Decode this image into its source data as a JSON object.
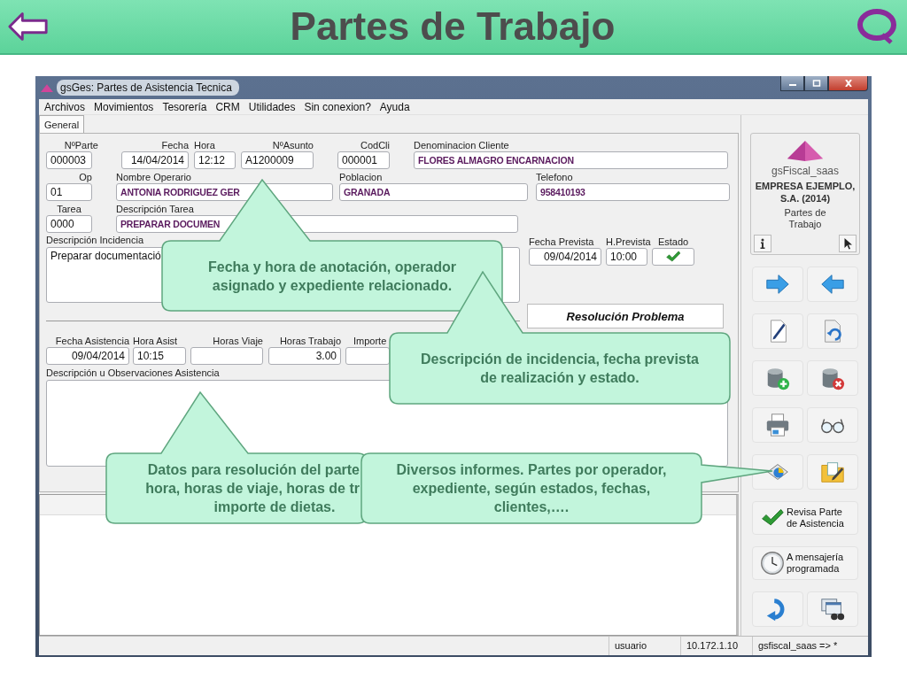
{
  "slide": {
    "title": "Partes de Trabajo"
  },
  "window": {
    "title": "gsGes: Partes de Asistencia Tecnica",
    "menu": [
      "Archivos",
      "Movimientos",
      "Tesorería",
      "CRM",
      "Utilidades",
      "Sin conexion?",
      "Ayuda"
    ],
    "tabs": [
      {
        "label": "General",
        "selected": true
      }
    ],
    "form": {
      "top_rows": [
        [
          {
            "label": "NºParte",
            "value": "000003",
            "kind": "code"
          },
          {
            "label": "Fecha",
            "value": "14/04/2014",
            "kind": "number"
          },
          {
            "label": "Hora",
            "value": "12:12",
            "kind": "code"
          },
          {
            "label": "NºAsunto",
            "value": "A1200009",
            "kind": "code"
          },
          {
            "label": "CodCli",
            "value": "000001",
            "kind": "code"
          },
          {
            "label": "Denominacion Cliente",
            "value": "FLORES ALMAGRO ENCARNACION",
            "kind": "name"
          }
        ],
        [
          {
            "label": "Op",
            "value": "01",
            "kind": "code"
          },
          {
            "label": "Nombre Operario",
            "value": "ANTONIA RODRIGUEZ GER",
            "kind": "name"
          },
          {
            "label": "Poblacion",
            "value": "GRANADA",
            "kind": "name"
          },
          {
            "label": "Telefono",
            "value": "958410193",
            "kind": "name"
          }
        ],
        [
          {
            "label": "Tarea",
            "value": "0000",
            "kind": "code"
          },
          {
            "label": "Descripción Tarea",
            "value": "PREPARAR DOCUMEN",
            "kind": "name"
          }
        ],
        [
          {
            "label": "Descripción Incidencia",
            "value": "Preparar documentació",
            "kind": "memo"
          },
          {
            "label": "Fecha Prevista",
            "value": "09/04/2014",
            "kind": "number"
          },
          {
            "label": "H.Prevista",
            "value": "10:00",
            "kind": "code"
          },
          {
            "label": "Estado",
            "kind": "status",
            "checked": true
          }
        ]
      ],
      "section_title": "Resolución Problema",
      "bottom_rows": [
        [
          {
            "label": "Fecha Asistencia",
            "value": "09/04/2014",
            "kind": "number"
          },
          {
            "label": "Hora Asist",
            "value": "10:15",
            "kind": "code"
          },
          {
            "label": "Horas Viaje",
            "kind": "number"
          },
          {
            "label": "Horas Trabajo",
            "value": "3.00",
            "kind": "number"
          },
          {
            "label": "Importe",
            "kind": "number"
          }
        ],
        [
          {
            "label": "Descripción u Observaciones Asistencia",
            "kind": "memo"
          }
        ]
      ]
    },
    "side_panel": {
      "app": "gsFiscal_saas",
      "company": "EMPRESA EJEMPLO, S.A. (2014)",
      "module": "Partes de Trabajo",
      "actions": [
        {
          "label": "Revisa Parte de Asistencia"
        },
        {
          "label": "A mensajería programada"
        }
      ]
    },
    "status_bar": [
      "usuario",
      "10.172.1.10",
      "gsfiscal_saas => *"
    ]
  },
  "callouts": [
    {
      "lines": [
        "Fecha y hora de anotación, operador",
        "asignado y expediente relacionado."
      ]
    },
    {
      "lines": [
        "Descripción de incidencia, fecha prevista",
        "de realización y estado."
      ]
    },
    {
      "lines": [
        "Datos para resolución del parte",
        "hora, horas de viaje, horas de tr",
        "importe de dietas."
      ]
    },
    {
      "lines": [
        "Diversos informes. Partes por operador,",
        "expediente, según estados, fechas,",
        "clientes,…."
      ]
    }
  ]
}
